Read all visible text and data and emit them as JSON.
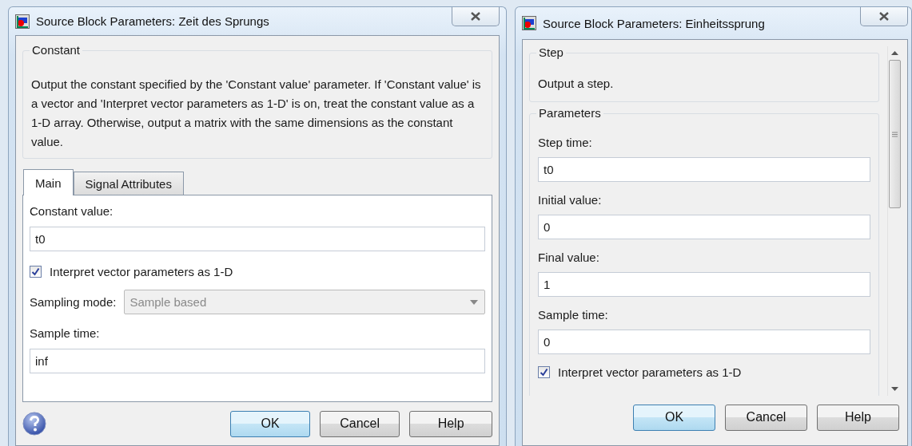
{
  "left_dialog": {
    "title": "Source Block Parameters: Zeit des Sprungs",
    "group": {
      "label": "Constant",
      "text": "Output the constant specified by the 'Constant value' parameter. If 'Constant value' is a vector and 'Interpret vector parameters as 1-D' is on, treat the constant value as a 1-D array. Otherwise, output a matrix with the same dimensions as the constant value."
    },
    "tabs": [
      {
        "label": "Main",
        "selected": true
      },
      {
        "label": "Signal Attributes",
        "selected": false
      }
    ],
    "fields": [
      {
        "kind": "text",
        "label": "Constant value:",
        "value": "t0"
      },
      {
        "kind": "checkbox",
        "label": "Interpret vector parameters as 1-D",
        "checked": true
      },
      {
        "kind": "select",
        "label": "Sampling mode:",
        "value": "Sample based",
        "disabled": true
      },
      {
        "kind": "text",
        "label": "Sample time:",
        "value": "inf"
      }
    ],
    "buttons": [
      {
        "label": "OK",
        "default": true
      },
      {
        "label": "Cancel",
        "default": false
      },
      {
        "label": "Help",
        "default": false
      }
    ]
  },
  "right_dialog": {
    "title": "Source Block Parameters: Einheitssprung",
    "group": {
      "label": "Step",
      "text": "Output a step."
    },
    "params_label": "Parameters",
    "fields": [
      {
        "kind": "text",
        "label": "Step time:",
        "value": "t0"
      },
      {
        "kind": "text",
        "label": "Initial value:",
        "value": "0"
      },
      {
        "kind": "text",
        "label": "Final value:",
        "value": "1"
      },
      {
        "kind": "text",
        "label": "Sample time:",
        "value": "0"
      },
      {
        "kind": "checkbox",
        "label": "Interpret vector parameters as 1-D",
        "checked": true
      }
    ],
    "buttons": [
      {
        "label": "OK",
        "default": true
      },
      {
        "label": "Cancel",
        "default": false
      },
      {
        "label": "Help",
        "default": false
      }
    ]
  }
}
